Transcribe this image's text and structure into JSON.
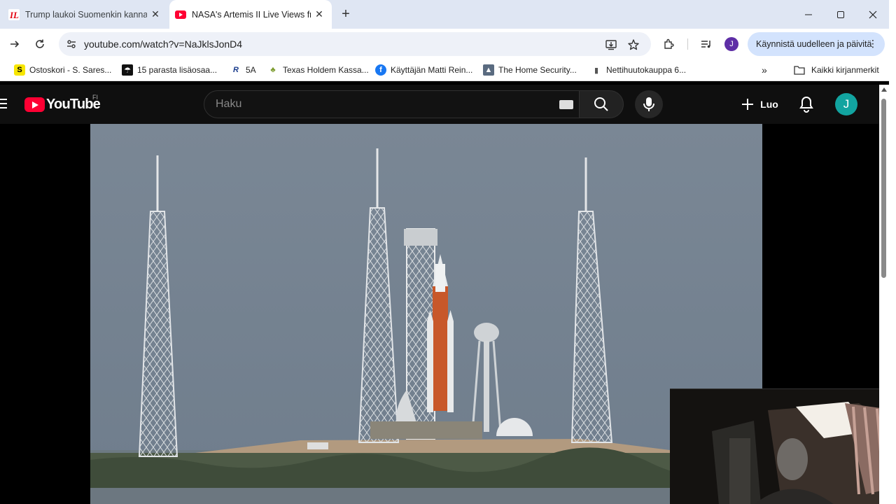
{
  "browser": {
    "tabs": [
      {
        "title": "Trump laukoi Suomenkin kanna",
        "favicon": "iltalehti-icon",
        "active": false
      },
      {
        "title": "NASA's Artemis II Live Views fro",
        "favicon": "youtube-icon",
        "active": true
      }
    ],
    "address": "youtube.com/watch?v=NaJklsJonD4",
    "update_button": "Käynnistä uudelleen ja päivitä",
    "profile_initial": "J",
    "bookmarks": [
      {
        "label": "Ostoskori - S. Sares...",
        "icon": "s-group-icon"
      },
      {
        "label": "15 parasta lisäosaa...",
        "icon": "umbrella-icon"
      },
      {
        "label": "5A",
        "icon": "r-icon"
      },
      {
        "label": "Texas Holdem Kassa...",
        "icon": "cards-icon"
      },
      {
        "label": "Käyttäjän Matti Rein...",
        "icon": "facebook-icon"
      },
      {
        "label": "The Home Security...",
        "icon": "person-icon"
      },
      {
        "label": "Nettihuutokauppa 6...",
        "icon": "bookmark-icon"
      }
    ],
    "bookmarks_overflow": "»",
    "all_bookmarks": "Kaikki kirjanmerkit"
  },
  "youtube": {
    "logo_text": "YouTube",
    "region": "FI",
    "search_placeholder": "Haku",
    "create_label": "Luo",
    "avatar_initial": "J",
    "accent": "#ff0033"
  }
}
